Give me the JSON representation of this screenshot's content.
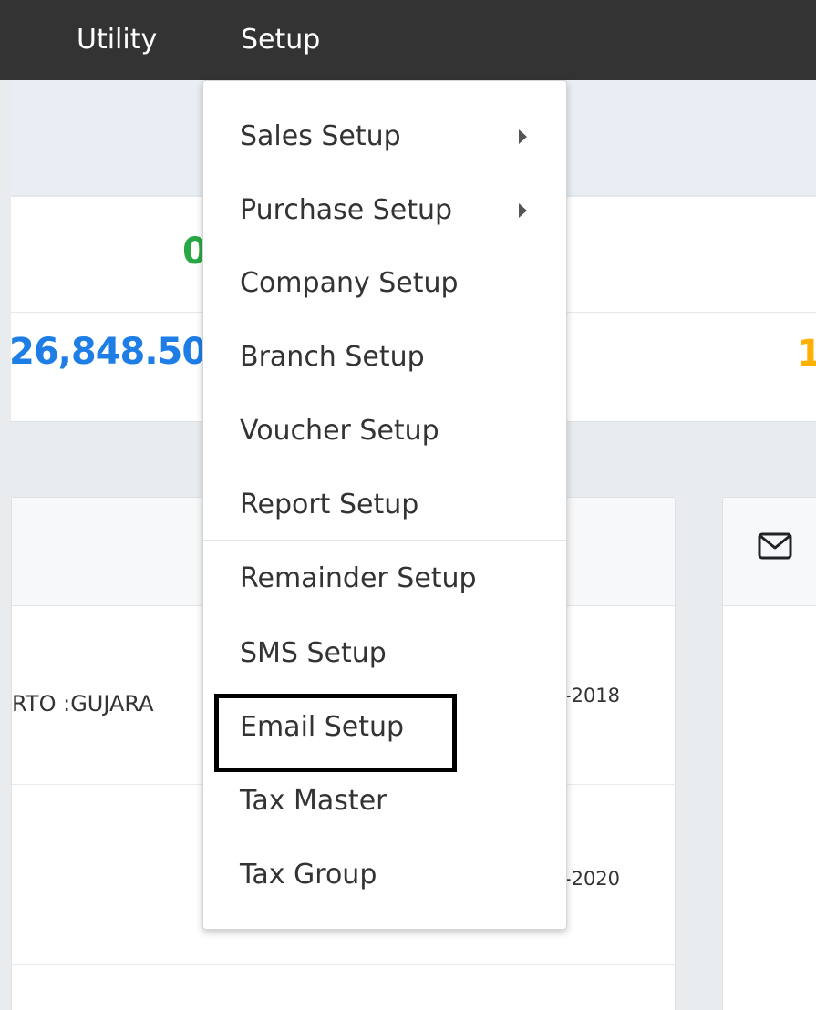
{
  "navbar": {
    "items": [
      {
        "label": "Utility"
      },
      {
        "label": "Setup"
      }
    ]
  },
  "stats": {
    "green_value": "0",
    "blue_value": "26,848.50",
    "yellow_value": "1"
  },
  "panel_left": {
    "rows": [
      {
        "name": "RTO :GUJARA",
        "date": "-2018"
      },
      {
        "name": "",
        "date": "-2020"
      }
    ]
  },
  "panel_right": {
    "header_icon": "envelope-icon"
  },
  "setup_menu": {
    "items": [
      {
        "label": "Sales Setup",
        "has_submenu": true
      },
      {
        "label": "Purchase Setup",
        "has_submenu": true
      },
      {
        "label": "Company Setup",
        "has_submenu": false
      },
      {
        "label": "Branch Setup",
        "has_submenu": false
      },
      {
        "label": "Voucher Setup",
        "has_submenu": false
      },
      {
        "label": "Report Setup",
        "has_submenu": false
      },
      {
        "label": "Remainder Setup",
        "has_submenu": false
      },
      {
        "label": "SMS Setup",
        "has_submenu": false
      },
      {
        "label": "Email Setup",
        "has_submenu": false,
        "highlighted": true
      },
      {
        "label": "Tax Master",
        "has_submenu": false
      },
      {
        "label": "Tax Group",
        "has_submenu": false
      }
    ]
  },
  "colors": {
    "navbar_bg": "#333333",
    "stat_green": "#28a745",
    "stat_blue": "#1e7ee6",
    "stat_yellow": "#ffb000",
    "highlight_border": "#000000"
  }
}
